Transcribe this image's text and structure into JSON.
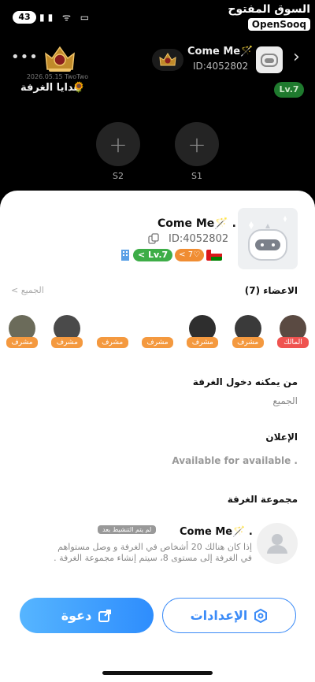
{
  "status_bar": {
    "battery": "43",
    "icons": "▮▮ ᯤ ▭"
  },
  "watermark": {
    "arabic": "السوق المفتوح",
    "english": "OpenSooq"
  },
  "room_header": {
    "crest_date": "2026.05.15  TwoTwo",
    "gifts_label": "هدايا الغرفة",
    "name": "Come Me🪄 .",
    "id": "ID:4052802",
    "level": "Lv.7"
  },
  "seats": [
    {
      "label": "S2",
      "plus": "+"
    },
    {
      "label": "S1",
      "plus": "+"
    }
  ],
  "sheet": {
    "name": "Come Me🪄 .",
    "id": "ID:4052802",
    "level_badge": "< Lv.7",
    "heart_badge": "< 7♡"
  },
  "members": {
    "title": "الاعضاء (7)",
    "all_link": "الجميع",
    "all_chevron": "<",
    "items": [
      {
        "tag": "مشرف",
        "owner": false,
        "photo": "#6b6b5a"
      },
      {
        "tag": "مشرف",
        "owner": false,
        "photo": "#4a4a4a"
      },
      {
        "tag": "مشرف",
        "owner": false,
        "photo": null
      },
      {
        "tag": "مشرف",
        "owner": false,
        "photo": null
      },
      {
        "tag": "مشرف",
        "owner": false,
        "photo": "#2e2e2e"
      },
      {
        "tag": "مشرف",
        "owner": false,
        "photo": "#3a3a3a"
      },
      {
        "tag": "المالك",
        "owner": true,
        "photo": "#5a4a42"
      }
    ]
  },
  "entry": {
    "title": "من يمكنه دخول الغرفة",
    "value": "الجميع"
  },
  "announcement": {
    "title": "الإعلان",
    "value": "Available for available ."
  },
  "group": {
    "title": "مجموعة الغرفة",
    "name": "Come Me🪄 .",
    "status": "لم يتم التنشيط بعد",
    "description": "إذا كان هنالك 20 أشخاص في الغرفة و وصل مستواهم في الغرفة إلى مستوى 8، سيتم إنشاء مجموعة الغرفة ."
  },
  "buttons": {
    "invite": "دعوة",
    "settings": "الإعدادات"
  },
  "colors": {
    "accent": "#3b8bf7",
    "tag": "#f4993f",
    "owner_tag": "#ef5350",
    "level": "#3dad47"
  }
}
